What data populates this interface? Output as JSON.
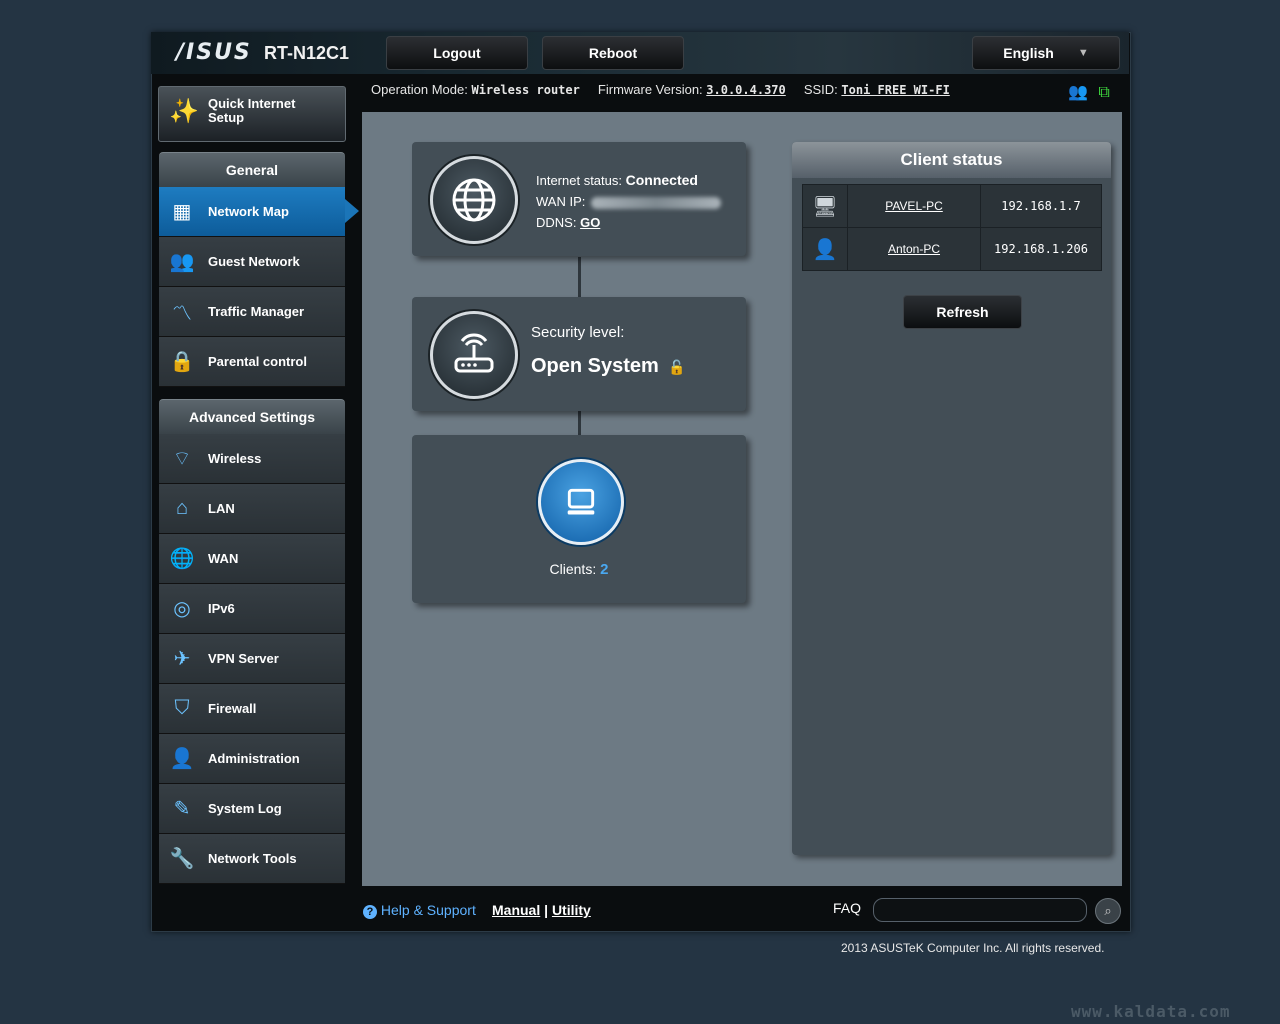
{
  "header": {
    "logo": "/ISUS",
    "model": "RT-N12C1",
    "logout": "Logout",
    "reboot": "Reboot",
    "language": "English"
  },
  "info": {
    "op_mode_label": "Operation Mode:",
    "op_mode_value": "Wireless router",
    "fw_label": "Firmware Version:",
    "fw_value": "3.0.0.4.370",
    "ssid_label": "SSID:",
    "ssid_value": "Toni FREE WI-FI"
  },
  "sidebar": {
    "qis_line1": "Quick Internet",
    "qis_line2": "Setup",
    "general_title": "General",
    "general_items": [
      {
        "label": "Network Map",
        "icon": "network-map-icon"
      },
      {
        "label": "Guest Network",
        "icon": "guest-network-icon"
      },
      {
        "label": "Traffic Manager",
        "icon": "traffic-manager-icon"
      },
      {
        "label": "Parental control",
        "icon": "lock-icon"
      }
    ],
    "advanced_title": "Advanced Settings",
    "advanced_items": [
      {
        "label": "Wireless",
        "icon": "wifi-icon"
      },
      {
        "label": "LAN",
        "icon": "home-icon"
      },
      {
        "label": "WAN",
        "icon": "globe-icon"
      },
      {
        "label": "IPv6",
        "icon": "ipv6-icon"
      },
      {
        "label": "VPN Server",
        "icon": "vpn-icon"
      },
      {
        "label": "Firewall",
        "icon": "shield-icon"
      },
      {
        "label": "Administration",
        "icon": "user-icon"
      },
      {
        "label": "System Log",
        "icon": "edit-icon"
      },
      {
        "label": "Network Tools",
        "icon": "wrench-icon"
      }
    ]
  },
  "map": {
    "internet_status_label": "Internet status:",
    "internet_status_value": "Connected",
    "wan_ip_label": "WAN IP:",
    "ddns_label": "DDNS:",
    "ddns_value": "GO",
    "security_label": "Security level:",
    "security_value": "Open System",
    "clients_label": "Clients:",
    "clients_value": "2"
  },
  "client_status": {
    "title": "Client status",
    "rows": [
      {
        "name": "PAVEL-PC",
        "ip": "192.168.1.7",
        "icon": "computer-icon"
      },
      {
        "name": "Anton-PC",
        "ip": "192.168.1.206",
        "icon": "user-icon"
      }
    ],
    "refresh": "Refresh"
  },
  "footer": {
    "help": "Help & Support",
    "manual": "Manual",
    "separator": "|",
    "utility": "Utility",
    "faq": "FAQ",
    "copyright": "2013 ASUSTeK Computer Inc. All rights reserved."
  },
  "watermark": "www.kaldata.com"
}
